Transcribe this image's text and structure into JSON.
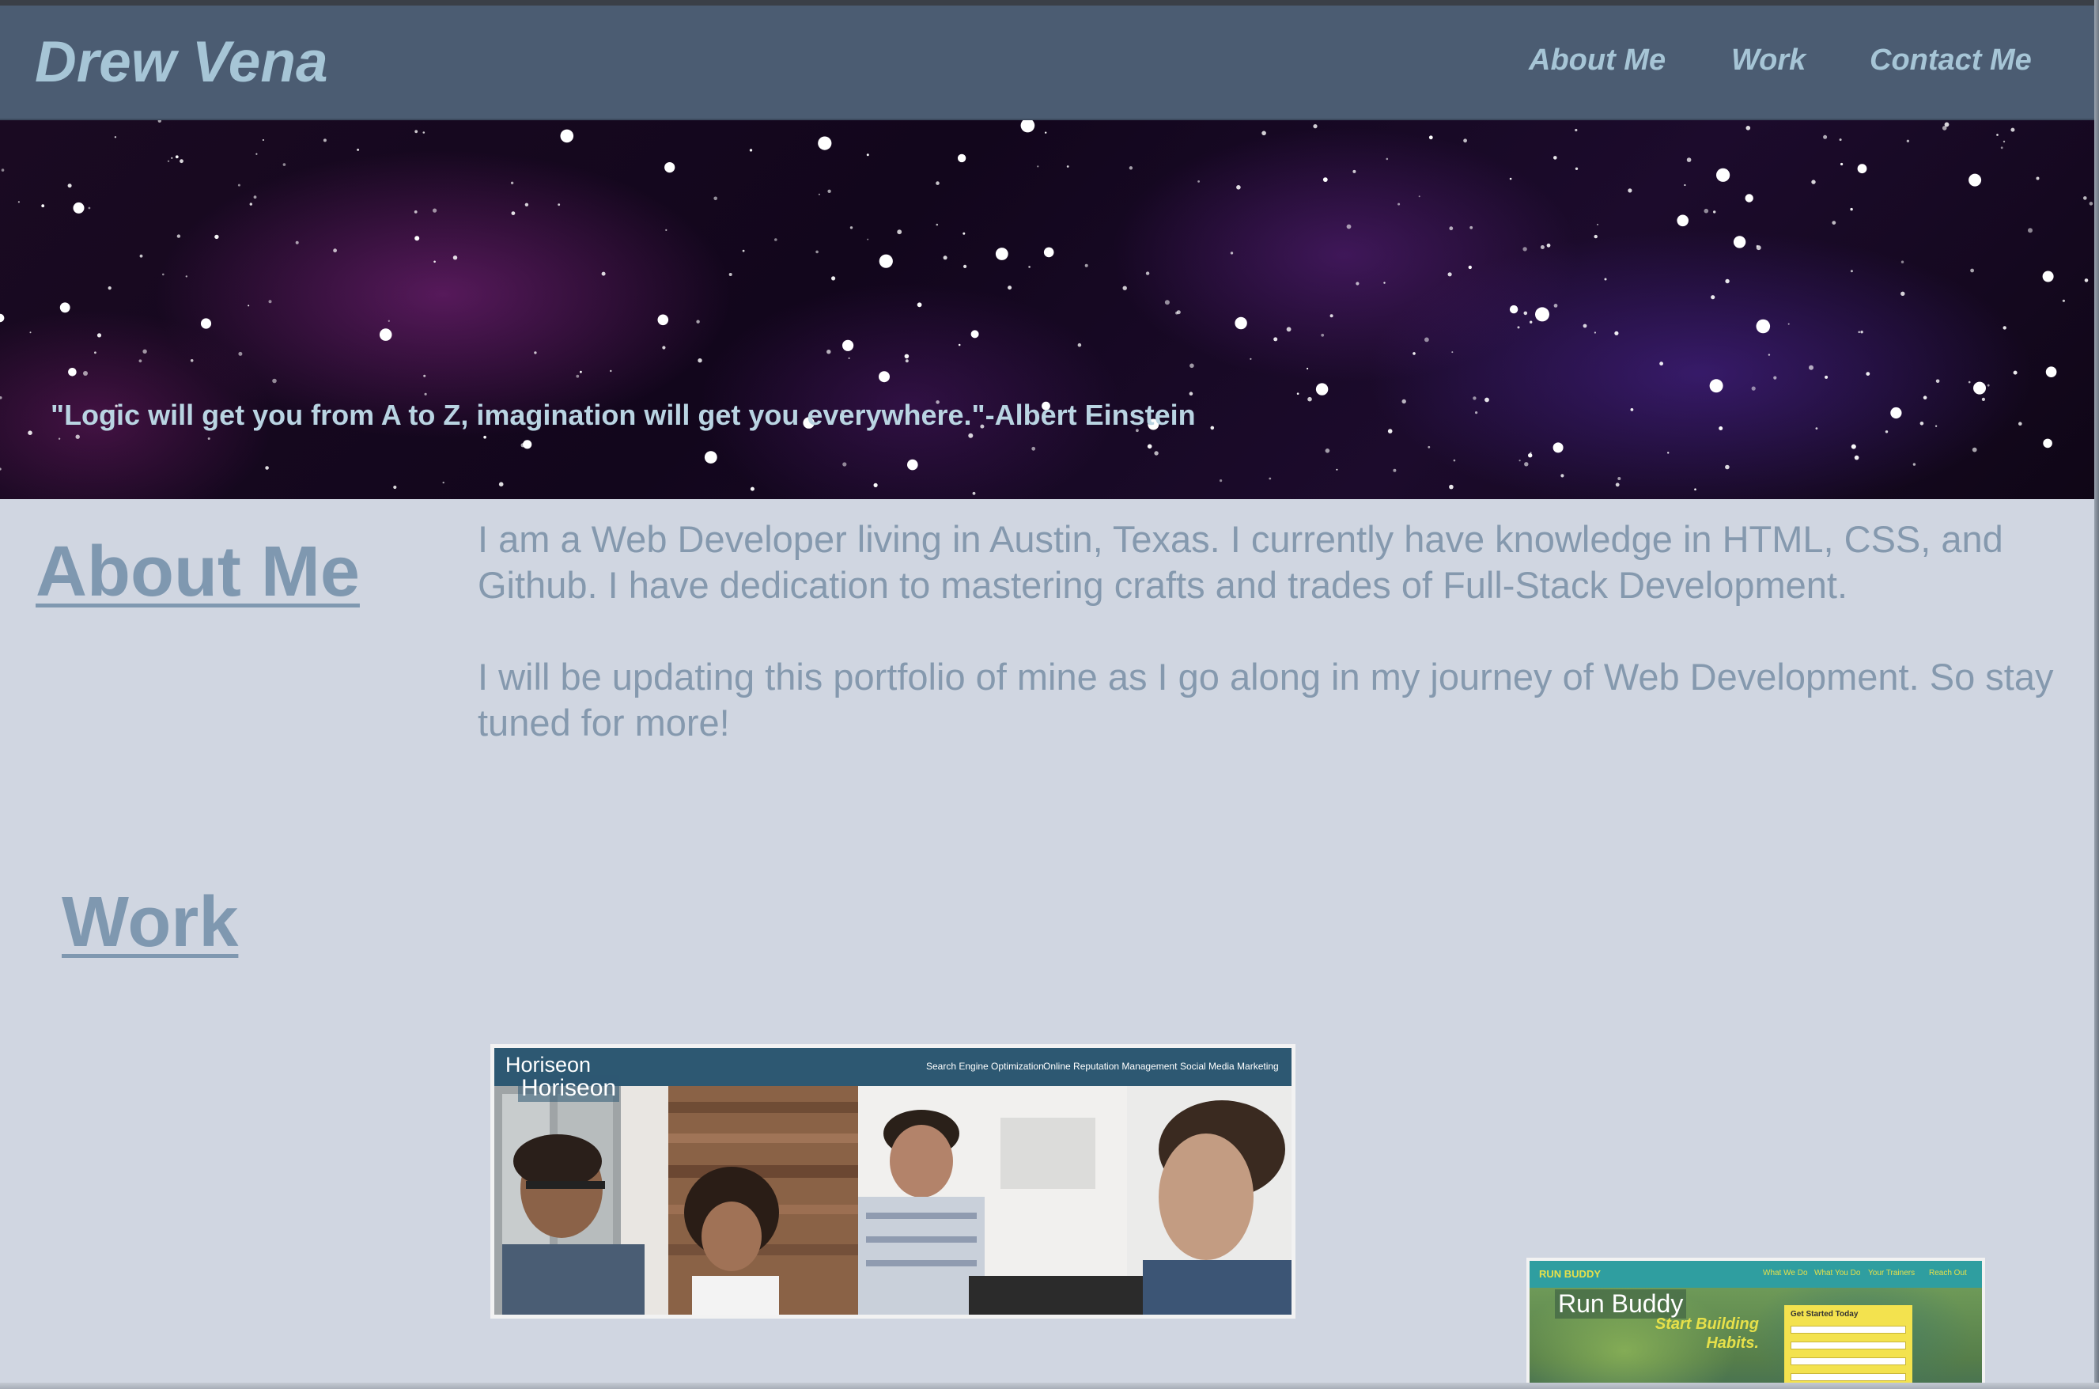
{
  "header": {
    "brand": "Drew Vena",
    "nav": [
      {
        "label": "About Me"
      },
      {
        "label": "Work"
      },
      {
        "label": "Contact Me"
      }
    ],
    "background_color": "#4b5c72",
    "text_color": "#a6c5d6"
  },
  "hero": {
    "quote": "\"Logic will get you from A to Z, imagination will get you everywhere.\"-Albert Einstein",
    "background_image": "purple-galaxy-starfield"
  },
  "about": {
    "heading": "About Me",
    "paragraphs": [
      "I am a Web Developer living in Austin, Texas. I currently have knowledge in HTML, CSS, and Github. I have dedication to mastering crafts and trades of Full-Stack Development.",
      "I will be updating this portfolio of mine as I go along in my journey of Web Development. So stay tuned for more!"
    ]
  },
  "work": {
    "heading": "Work",
    "projects": [
      {
        "title": "Horiseon",
        "screenshot": {
          "logo": "Horiseon",
          "nav": [
            "Search Engine Optimization",
            "Online Reputation Management",
            "Social Media Marketing"
          ],
          "bar_color": "#2d5872"
        }
      },
      {
        "title": "Run Buddy",
        "screenshot": {
          "brand": "RUN BUDDY",
          "nav": [
            "What We Do",
            "What You Do",
            "Your Trainers",
            "Reach Out"
          ],
          "tagline": "Start Building Habits.",
          "form_title": "Get Started Today",
          "accent_color": "#e6e04a"
        }
      }
    ]
  },
  "colors": {
    "page_background": "#d0d6e1",
    "heading_color": "#7f98b0",
    "body_text_color": "#8599ae"
  }
}
